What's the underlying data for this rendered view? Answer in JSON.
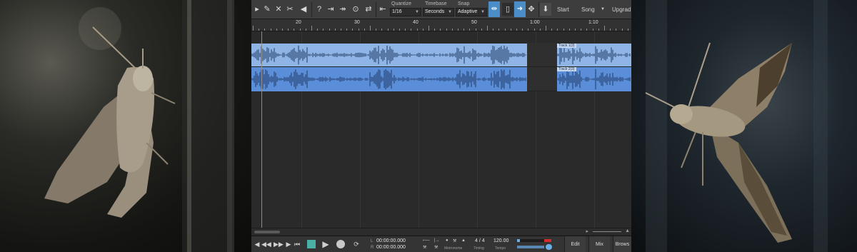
{
  "toolbar": {
    "quantize_label": "Quantize",
    "quantize_value": "1/16",
    "timebase_label": "Timebase",
    "timebase_value": "Seconds",
    "snap_label": "Snap",
    "snap_value": "Adaptive",
    "start_label": "Start",
    "song_label": "Song",
    "upgrade_label": "Upgrad"
  },
  "ruler": {
    "labels": [
      "20",
      "30",
      "40",
      "50",
      "1:00",
      "1:10"
    ]
  },
  "tracks": [
    {
      "clip_title": "Track 1(3)"
    },
    {
      "clip_title": "Track 2(3)"
    }
  ],
  "transport": {
    "loop_l_label": "L",
    "loop_l_value": "00:00:00.000",
    "loop_r_label": "R",
    "loop_r_value": "00:00:00.000",
    "metronome_label": "Metronome",
    "timing_label": "Timing",
    "timing_value": "4 / 4",
    "tempo_label": "Tempo",
    "tempo_value": "120.00",
    "edit_label": "Edit",
    "mix_label": "Mix",
    "browse_label": "Brows"
  },
  "colors": {
    "clip_light": "#8fb5e6",
    "clip_dark": "#5b8ed8",
    "toggle_active": "#4a8dc7",
    "meter_red": "#d62b2b"
  }
}
